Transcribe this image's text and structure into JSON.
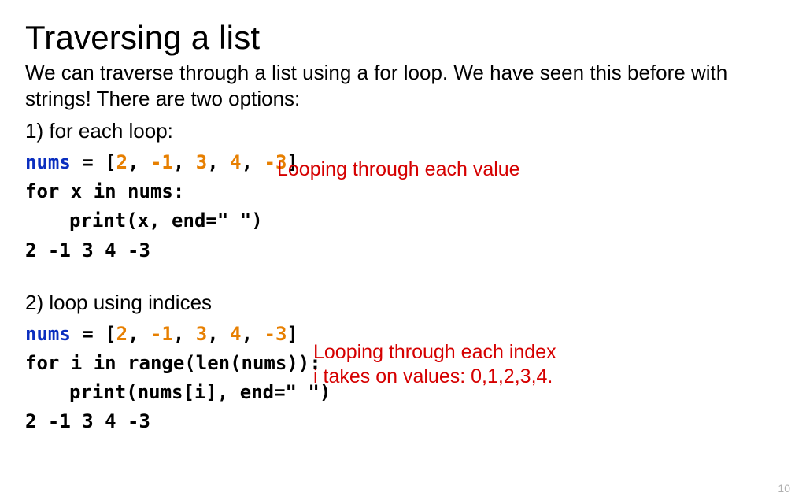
{
  "title": "Traversing a list",
  "intro": "We can traverse through a list using a for loop.  We have seen this before with strings! There are two options:",
  "option1": "1) for each loop:",
  "code1": {
    "nums_var": "nums",
    "eq": " = ",
    "lb": "[",
    "v1": "2",
    "c": ", ",
    "v2": "-1",
    "v3": "3",
    "v4": "4",
    "v5": "-3",
    "rb": "]",
    "for_line": "for x in nums:",
    "print_line": "print(x, end=\" \")",
    "output": "2 -1 3 4 -3"
  },
  "annotation1": "Looping through each value",
  "option2": "2) loop using indices",
  "code2": {
    "for_line": "for i in range(len(nums)):",
    "print_line": "print(nums[i], end=\" \")",
    "output": "2 -1 3 4 -3"
  },
  "annotation2_line1": "Looping through each index",
  "annotation2_line2": "i takes on values: 0,1,2,3,4.",
  "page_number": "10"
}
